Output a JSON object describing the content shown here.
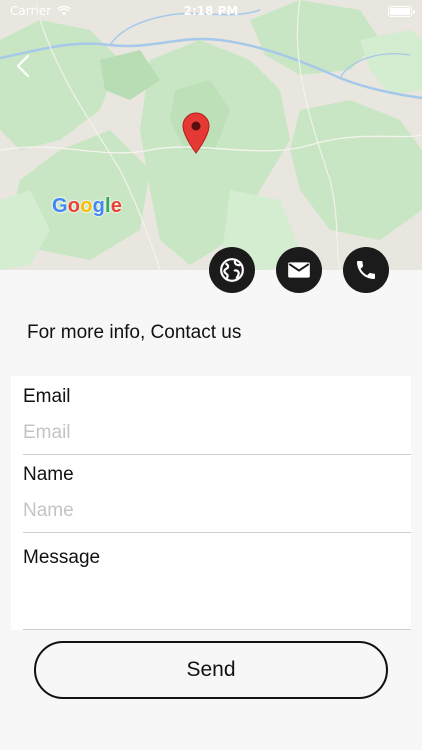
{
  "status_bar": {
    "carrier": "Carrier",
    "time": "2:18 PM",
    "battery_level": 1.0
  },
  "map": {
    "provider_logo": "Google",
    "pin_icon": "map-pin-icon"
  },
  "navigation": {
    "back_icon": "chevron-left-icon"
  },
  "contact_actions": [
    {
      "name": "website",
      "icon": "globe-icon"
    },
    {
      "name": "email",
      "icon": "envelope-icon"
    },
    {
      "name": "phone",
      "icon": "phone-icon"
    }
  ],
  "info_text": "For more info, Contact us",
  "form": {
    "email_label": "Email",
    "email_placeholder": "Email",
    "name_label": "Name",
    "name_placeholder": "Name",
    "message_label": "Message",
    "message_value": ""
  },
  "send_button_label": "Send",
  "colors": {
    "map_green": "#c8e6c4",
    "map_land": "#e8e6df",
    "map_water": "#a6c8ea",
    "pin_red": "#e53935",
    "icon_bg": "#1b1b1b",
    "page_bg": "#f7f7f7"
  }
}
